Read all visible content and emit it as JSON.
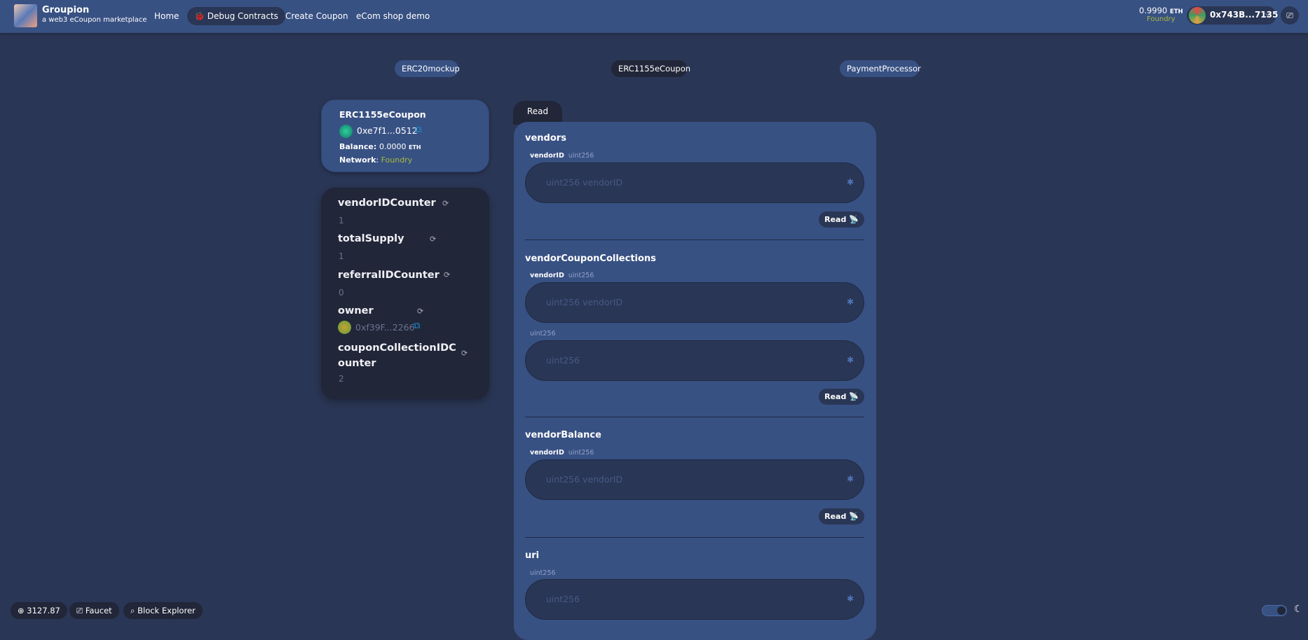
{
  "header": {
    "brand": "Groupion",
    "tagline": "a web3 eCoupon marketplace",
    "nav": [
      "Home",
      "Debug Contracts",
      "Create Coupon",
      "eCom shop demo"
    ],
    "balance": "0.9990",
    "balance_unit": "ETH",
    "network": "Foundry",
    "address": "0x743B...7135"
  },
  "contract_tabs": [
    "ERC20mockup",
    "ERC1155eCoupon",
    "PaymentProcessor"
  ],
  "contract": {
    "name": "ERC1155eCoupon",
    "address": "0xe7f1...0512",
    "balance_label": "Balance:",
    "balance": "0.0000",
    "balance_unit": "ETH",
    "network_label": "Network",
    "network": "Foundry"
  },
  "vars": [
    {
      "name": "vendorIDCounter",
      "value": "1"
    },
    {
      "name": "totalSupply",
      "value": "1"
    },
    {
      "name": "referralIDCounter",
      "value": "0"
    },
    {
      "name": "owner",
      "value": "0xf39F...2266"
    },
    {
      "name": "couponCollectionIDCounter",
      "value": "2"
    }
  ],
  "read_tab": "Read",
  "functions": [
    {
      "name": "vendors",
      "params": [
        {
          "label": "vendorID",
          "type": "uint256",
          "placeholder": "uint256 vendorID"
        }
      ]
    },
    {
      "name": "vendorCouponCollections",
      "params": [
        {
          "label": "vendorID",
          "type": "uint256",
          "placeholder": "uint256 vendorID"
        },
        {
          "label": "",
          "type": "uint256",
          "placeholder": "uint256"
        }
      ]
    },
    {
      "name": "vendorBalance",
      "params": [
        {
          "label": "vendorID",
          "type": "uint256",
          "placeholder": "uint256 vendorID"
        }
      ]
    },
    {
      "name": "uri",
      "params": [
        {
          "label": "",
          "type": "uint256",
          "placeholder": "uint256"
        }
      ]
    }
  ],
  "read_button": "Read 📡",
  "footer": {
    "price": "3127.87",
    "faucet": "Faucet",
    "explorer": "Block Explorer"
  },
  "colors": {
    "bg": "#2a3655",
    "primary": "#385183",
    "dark": "#212638",
    "network": "#a7b83a"
  }
}
